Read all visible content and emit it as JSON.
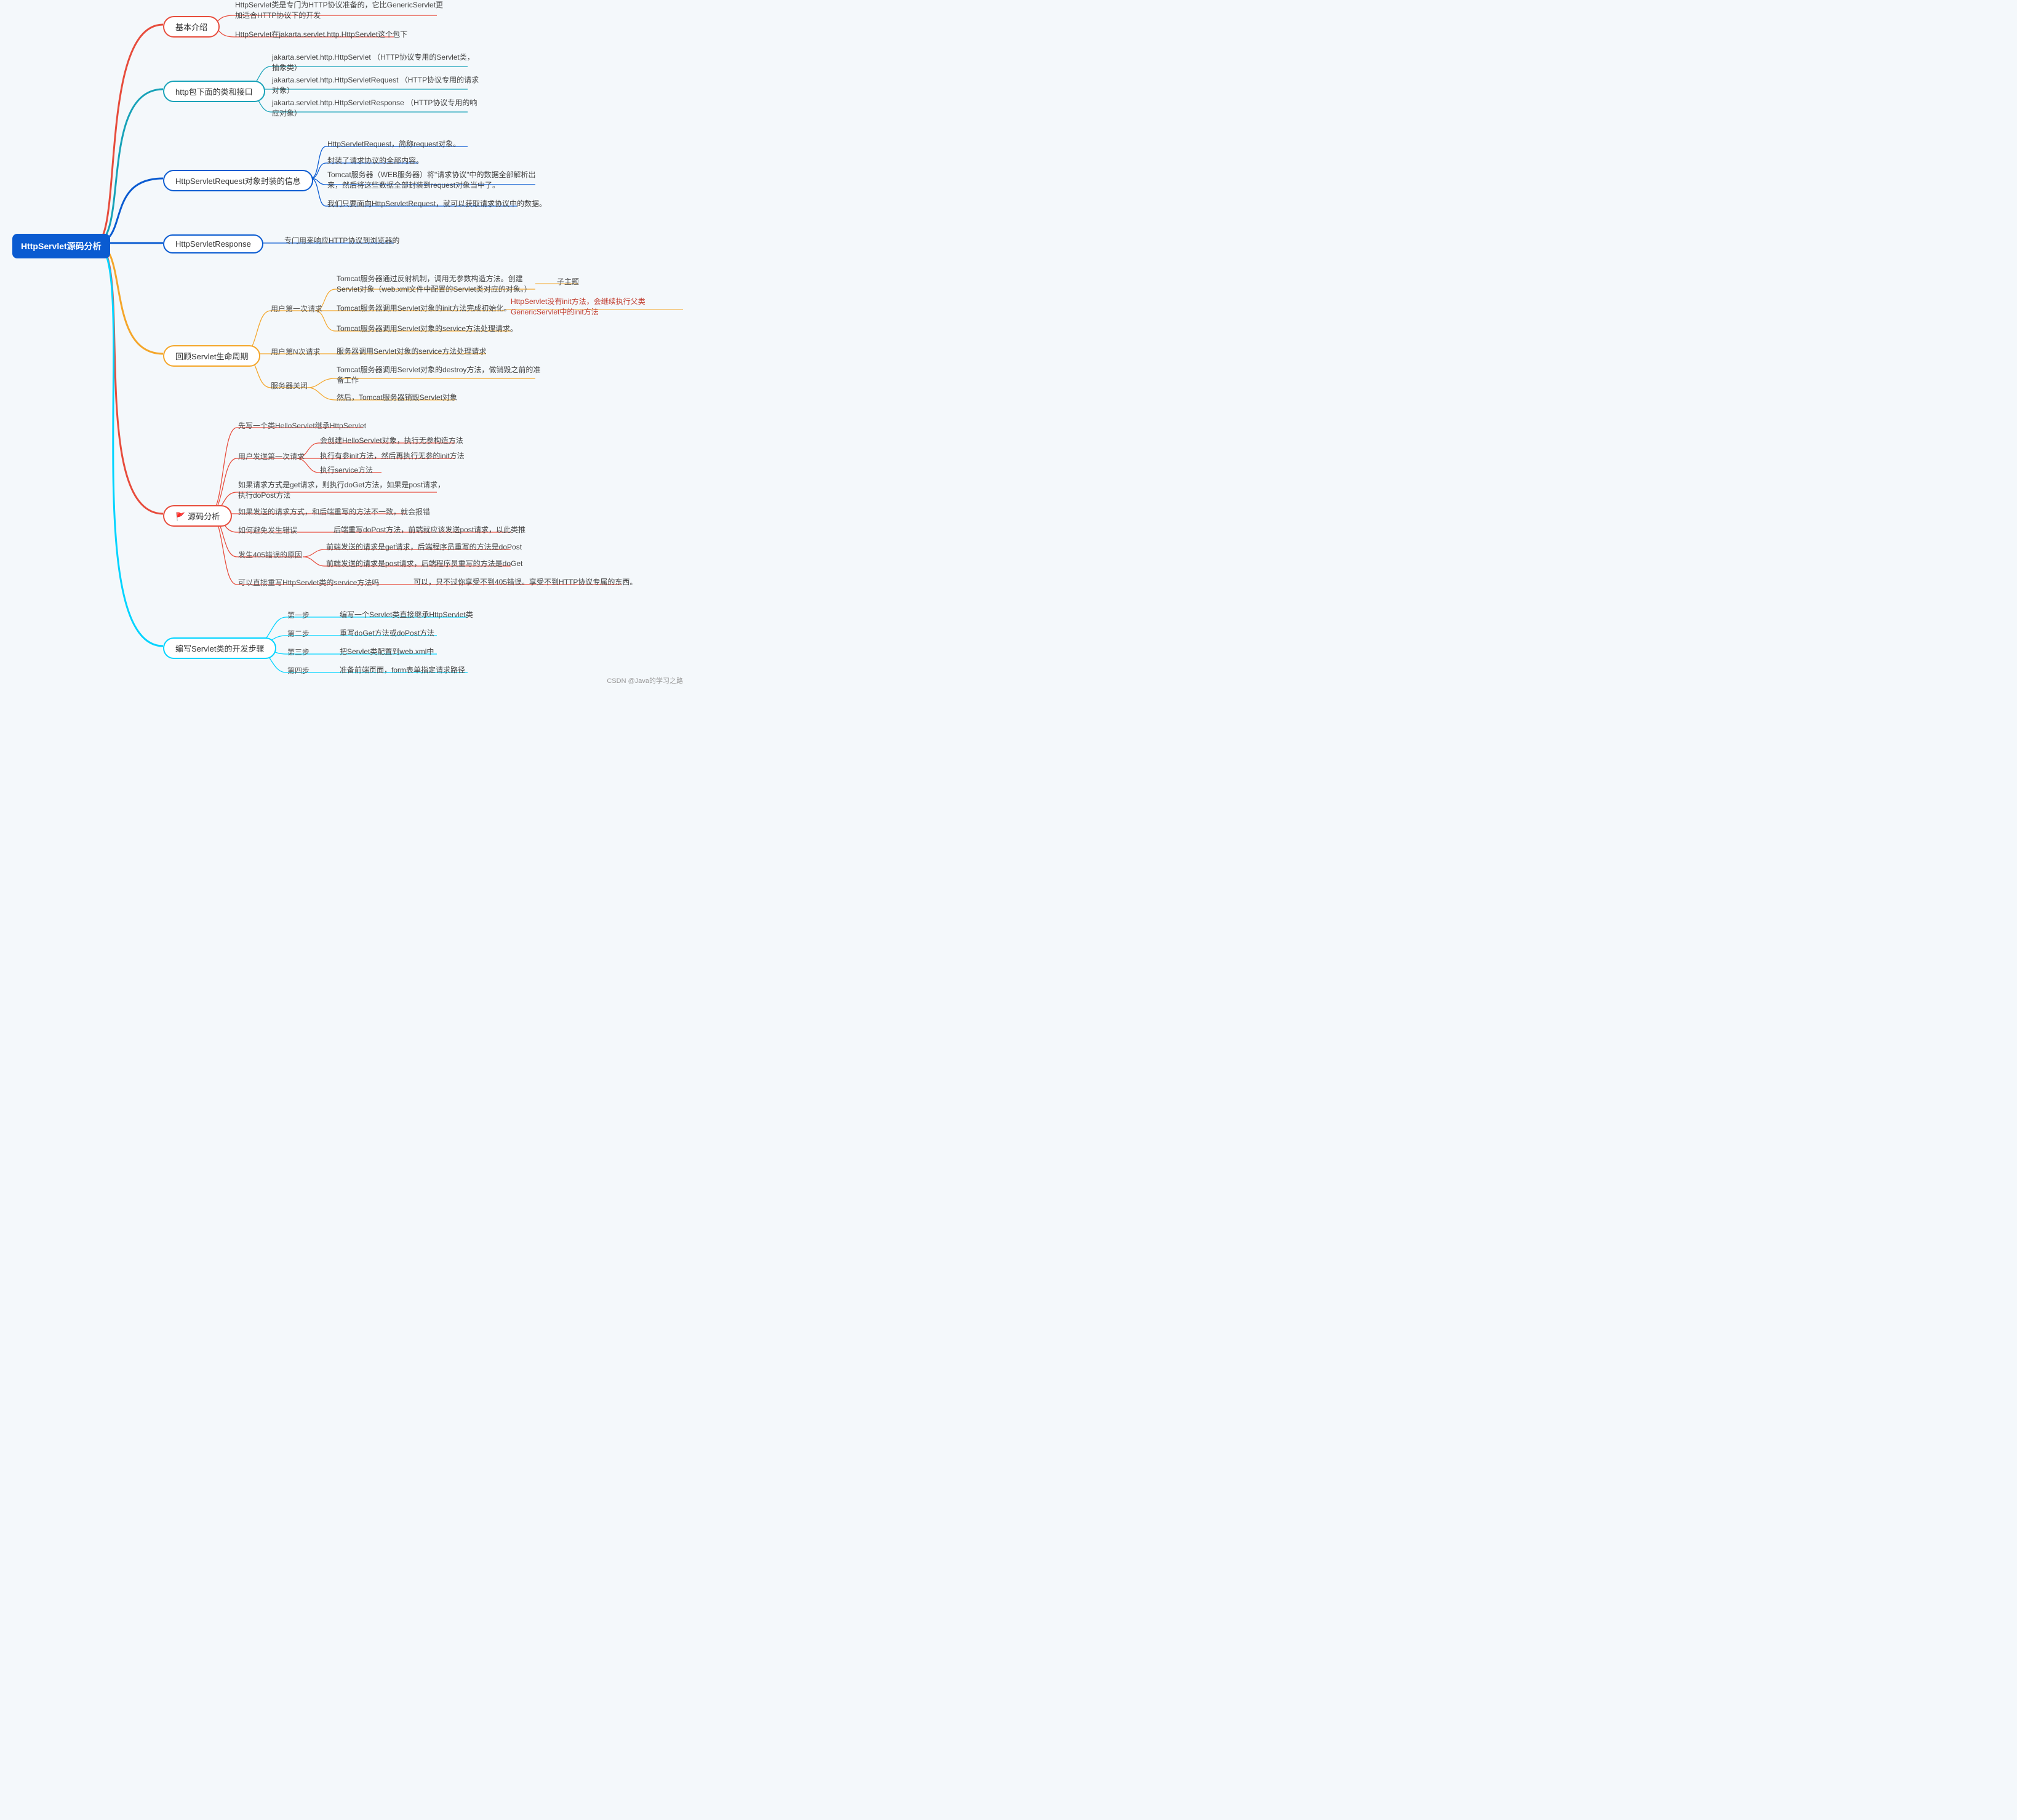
{
  "root": {
    "title": "HttpServlet源码分析"
  },
  "branches": [
    {
      "id": "b1",
      "label": "基本介绍",
      "color": "#e74c3c",
      "leaves": [
        {
          "text": "HttpServlet类是专门为HTTP协议准备的，它比GenericServlet更加适合HTTP协议下的开发"
        },
        {
          "text": "HttpServlet在jakarta.servlet.http.HttpServlet这个包下"
        }
      ]
    },
    {
      "id": "b2",
      "label": "http包下面的类和接口",
      "color": "#17a2b8",
      "leaves": [
        {
          "text": "jakarta.servlet.http.HttpServlet （HTTP协议专用的Servlet类，抽象类）"
        },
        {
          "text": "jakarta.servlet.http.HttpServletRequest （HTTP协议专用的请求对象）"
        },
        {
          "text": "jakarta.servlet.http.HttpServletResponse （HTTP协议专用的响应对象）"
        }
      ]
    },
    {
      "id": "b3",
      "label": "HttpServletRequest对象封装的信息",
      "color": "#0a5bd1",
      "leaves": [
        {
          "text": "HttpServletRequest，简称request对象。"
        },
        {
          "text": "封装了请求协议的全部内容。"
        },
        {
          "text": "Tomcat服务器（WEB服务器）将\"请求协议\"中的数据全部解析出来，然后将这些数据全部封装到request对象当中了。"
        },
        {
          "text": "我们只要面向HttpServletRequest，就可以获取请求协议中的数据。"
        }
      ]
    },
    {
      "id": "b4",
      "label": "HttpServletResponse",
      "color": "#0a5bd1",
      "leaves": [
        {
          "text": "专门用来响应HTTP协议到浏览器的"
        }
      ]
    },
    {
      "id": "b5",
      "label": "回顾Servlet生命周期",
      "color": "#f4a62a",
      "subs": [
        {
          "label": "用户第一次请求",
          "leaves": [
            {
              "text": "Tomcat服务器通过反射机制，调用无参数构造方法。创建Servlet对象（web.xml文件中配置的Servlet类对应的对象。）",
              "annot": "子主题"
            },
            {
              "text": "Tomcat服务器调用Servlet对象的init方法完成初始化。",
              "annot_red": "HttpServlet没有init方法，会继续执行父类GenericServlet中的init方法"
            },
            {
              "text": "Tomcat服务器调用Servlet对象的service方法处理请求。"
            }
          ]
        },
        {
          "label": "用户第N次请求",
          "leaves": [
            {
              "text": "服务器调用Servlet对象的service方法处理请求"
            }
          ]
        },
        {
          "label": "服务器关闭",
          "leaves": [
            {
              "text": "Tomcat服务器调用Servlet对象的destroy方法，做销毁之前的准备工作"
            },
            {
              "text": "然后，Tomcat服务器销毁Servlet对象"
            }
          ]
        }
      ]
    },
    {
      "id": "b6",
      "label": "源码分析",
      "flag": true,
      "color": "#e74c3c",
      "subs": [
        {
          "label": "先写一个类HelloServlet继承HttpServlet",
          "leaves": []
        },
        {
          "label": "用户发送第一次请求",
          "leaves": [
            {
              "text": "会创建HelloServlet对象，执行无参构造方法"
            },
            {
              "text": "执行有参init方法，然后再执行无参的init方法"
            },
            {
              "text": "执行service方法"
            }
          ]
        },
        {
          "label": "如果请求方式是get请求，则执行doGet方法，如果是post请求，执行doPost方法",
          "leaves": []
        },
        {
          "label": "如果发送的请求方式，和后端重写的方法不一致，就会报错",
          "leaves": []
        },
        {
          "label": "如何避免发生错误",
          "leaves": [
            {
              "text": "后端重写doPost方法，前端就应该发送post请求，以此类推"
            }
          ]
        },
        {
          "label": "发生405错误的原因",
          "leaves": [
            {
              "text": "前端发送的请求是get请求，后端程序员重写的方法是doPost"
            },
            {
              "text": "前端发送的请求是post请求，后端程序员重写的方法是doGet"
            }
          ]
        },
        {
          "label": "可以直接重写HttpServlet类的service方法吗",
          "leaves": [
            {
              "text": "可以，只不过你享受不到405错误。享受不到HTTP协议专属的东西。"
            }
          ]
        }
      ]
    },
    {
      "id": "b7",
      "label": "编写Servlet类的开发步骤",
      "color": "#00d4ff",
      "subs": [
        {
          "label": "第一步",
          "leaves": [
            {
              "text": "编写一个Servlet类直接继承HttpServlet类"
            }
          ]
        },
        {
          "label": "第二步",
          "leaves": [
            {
              "text": "重写doGet方法或doPost方法"
            }
          ]
        },
        {
          "label": "第三步",
          "leaves": [
            {
              "text": "把Servlet类配置到web.xml中"
            }
          ]
        },
        {
          "label": "第四步",
          "leaves": [
            {
              "text": "准备前端页面，form表单指定请求路径"
            }
          ]
        }
      ]
    }
  ],
  "watermark": "CSDN @Java的学习之路"
}
